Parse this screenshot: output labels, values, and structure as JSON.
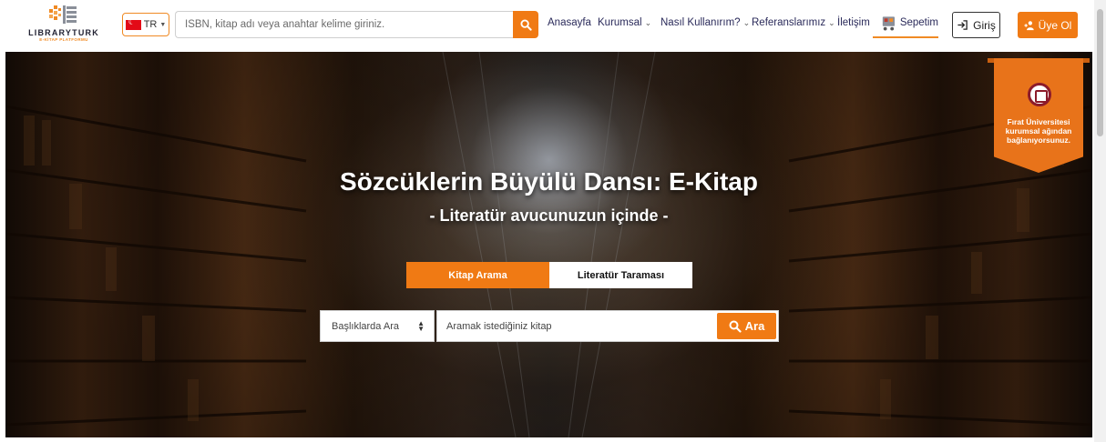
{
  "brand": {
    "name": "LIBRARYTURK",
    "tagline": "E-KİTAP PLATFORMU"
  },
  "header": {
    "language": "TR",
    "search_placeholder": "ISBN, kitap adı veya anahtar kelime giriniz.",
    "nav": [
      {
        "label": "Anasayfa",
        "dropdown": false
      },
      {
        "label": "Kurumsal",
        "dropdown": true
      },
      {
        "label": "Nasıl Kullanırım?",
        "dropdown": true
      },
      {
        "label": "Referanslarımız",
        "dropdown": true
      },
      {
        "label": "İletişim",
        "dropdown": false
      }
    ],
    "cart_label": "Sepetim",
    "login_label": "Giriş",
    "register_label": "Üye Ol"
  },
  "hero": {
    "title": "Sözcüklerin Büyülü Dansı: E-Kitap",
    "subtitle": "- Literatür avucunuzun içinde -",
    "tabs": [
      {
        "label": "Kitap Arama",
        "active": true
      },
      {
        "label": "Literatür Taraması",
        "active": false
      }
    ],
    "search_scope": "Başlıklarda Ara",
    "search_placeholder": "Aramak istediğiniz kitap",
    "search_button": "Ara"
  },
  "ribbon": {
    "line1": "Fırat Üniversitesi",
    "line2": "kurumsal ağından",
    "line3": "bağlanıyorsunuz."
  },
  "colors": {
    "accent": "#f07a14",
    "nav_text": "#2a2a5a",
    "seal": "#8c1b2a"
  },
  "icons": [
    "turkey-flag-icon",
    "search-icon",
    "chevron-down-icon",
    "cart-icon",
    "login-icon",
    "add-user-icon",
    "university-seal-icon"
  ]
}
